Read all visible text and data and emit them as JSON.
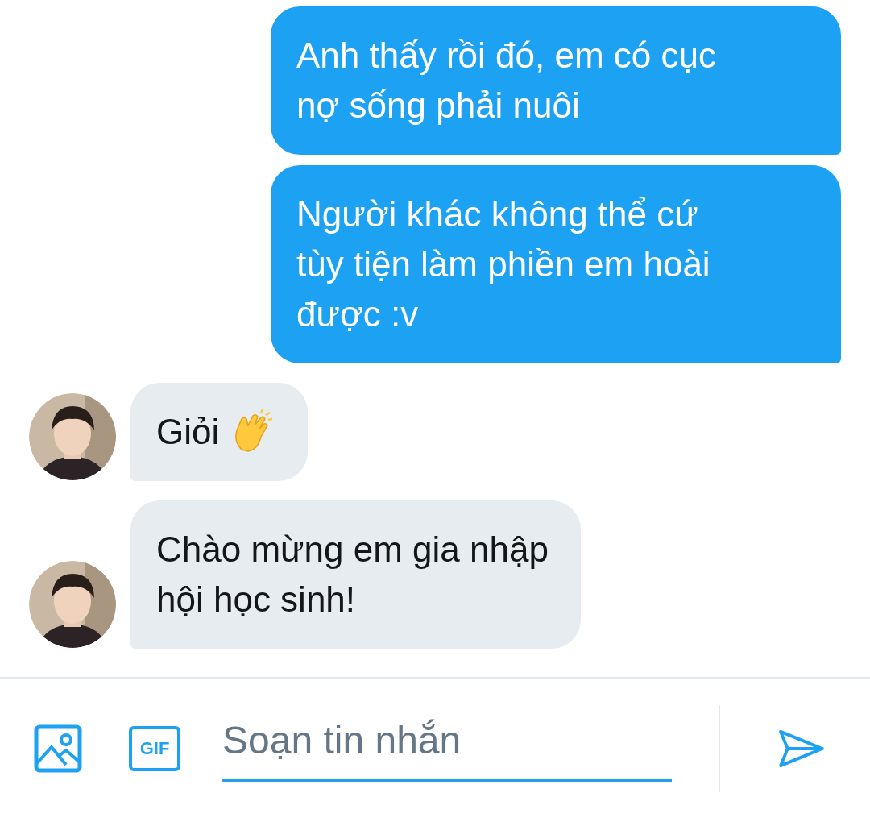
{
  "messages": [
    {
      "kind": "outgoing",
      "lines": [
        "Anh thấy rồi đó, em có cục",
        "nợ sống phải nuôi"
      ]
    },
    {
      "kind": "outgoing",
      "lines": [
        "Người khác không thể cứ",
        "tùy tiện làm phiền em hoài",
        "được :v"
      ]
    },
    {
      "kind": "incoming",
      "lines": [
        "Giỏi"
      ],
      "has_emoji": true
    },
    {
      "kind": "incoming",
      "lines": [
        "Chào mừng em gia nhập",
        "hội học sinh!"
      ]
    }
  ],
  "composer": {
    "placeholder": "Soạn tin nhắn",
    "gif_label": "GIF"
  }
}
